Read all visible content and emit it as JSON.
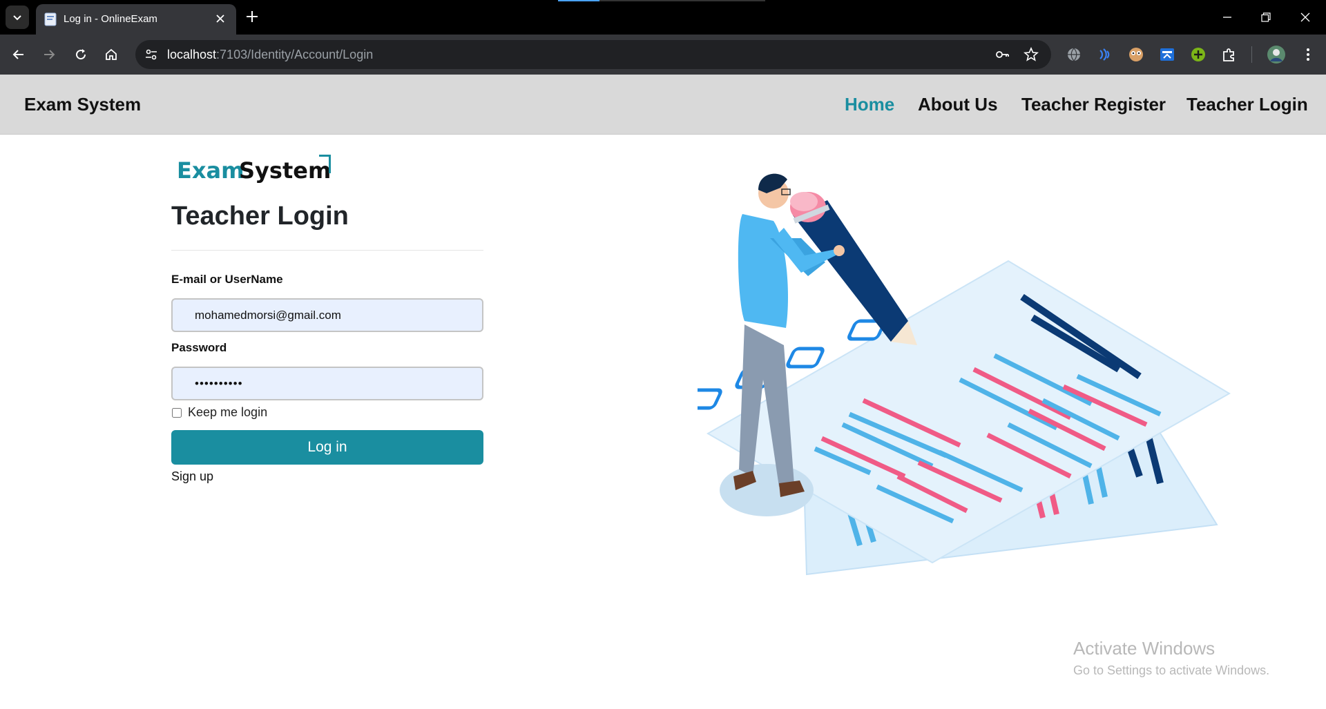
{
  "browser": {
    "tab_title": "Log in - OnlineExam",
    "url_host": "localhost",
    "url_rest": ":7103/Identity/Account/Login"
  },
  "navbar": {
    "brand": "Exam System",
    "links": [
      {
        "label": "Home",
        "active": true
      },
      {
        "label": "About Us",
        "active": false
      },
      {
        "label": "Teacher Register",
        "active": false
      },
      {
        "label": "Teacher Login",
        "active": false
      }
    ]
  },
  "logo": {
    "word1": "Exam",
    "word2": "System"
  },
  "form": {
    "title": "Teacher Login",
    "email_label": "E-mail or UserName",
    "email_value": "mohamedmorsi@gmail.com",
    "password_label": "Password",
    "password_value": "••••••••••",
    "remember_label": "Keep me login",
    "remember_checked": false,
    "submit_label": "Log in",
    "signup_label": "Sign up"
  },
  "watermark": {
    "line1": "Activate Windows",
    "line2": "Go to Settings to activate Windows."
  },
  "colors": {
    "accent": "#1a8ea0",
    "navbar_bg": "#d9d9d9",
    "input_bg": "#e8f0fe"
  }
}
